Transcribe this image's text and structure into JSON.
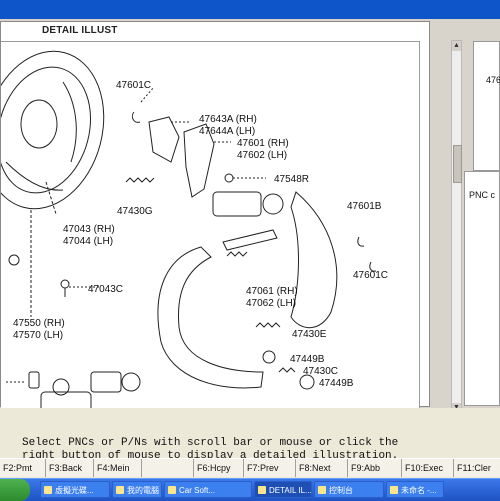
{
  "window": {
    "title_bar_color": "#0d55c8"
  },
  "illustration": {
    "title": "DETAIL ILLUST",
    "part_labels": [
      {
        "id": "p1",
        "text": "47601C"
      },
      {
        "id": "p2",
        "text": "47643A (RH)"
      },
      {
        "id": "p3",
        "text": "47644A (LH)"
      },
      {
        "id": "p4",
        "text": "47601 (RH)"
      },
      {
        "id": "p5",
        "text": "47602 (LH)"
      },
      {
        "id": "p6",
        "text": "47548R"
      },
      {
        "id": "p7",
        "text": "47430G"
      },
      {
        "id": "p8",
        "text": "47601B"
      },
      {
        "id": "p9",
        "text": "47043 (RH)"
      },
      {
        "id": "p10",
        "text": "47044 (LH)"
      },
      {
        "id": "p11",
        "text": "47043C"
      },
      {
        "id": "p12",
        "text": "47601C"
      },
      {
        "id": "p13",
        "text": "47061 (RH)"
      },
      {
        "id": "p14",
        "text": "47062 (LH)"
      },
      {
        "id": "p15",
        "text": "47550 (RH)"
      },
      {
        "id": "p16",
        "text": "47570 (LH)"
      },
      {
        "id": "p17",
        "text": "47430E"
      },
      {
        "id": "p18",
        "text": "47449B"
      },
      {
        "id": "p19",
        "text": "47430C"
      },
      {
        "id": "p20",
        "text": "47449B"
      }
    ]
  },
  "side_panel": {
    "top_label": "476",
    "bottom_label": "PNC c"
  },
  "instructions": {
    "line1": "Select PNCs or P/Ns with scroll bar or mouse or click the",
    "line2": "right button of mouse to display a detailed illustration."
  },
  "function_keys": [
    {
      "label": "F2:Pmt"
    },
    {
      "label": "F3:Back"
    },
    {
      "label": "F4:Mein"
    },
    {
      "label": ""
    },
    {
      "label": "F6:Hcpy"
    },
    {
      "label": "F7:Prev"
    },
    {
      "label": "F8:Next"
    },
    {
      "label": "F9:Abb"
    },
    {
      "label": "F10:Exec"
    },
    {
      "label": "F11:Cler"
    }
  ],
  "taskbar": {
    "tasks": [
      {
        "label": "虛擬光碟..."
      },
      {
        "label": "我的電腦"
      },
      {
        "label": "Car Soft..."
      },
      {
        "label": "DETAIL IL..."
      },
      {
        "label": "控制台"
      },
      {
        "label": "未命名 -..."
      }
    ]
  }
}
